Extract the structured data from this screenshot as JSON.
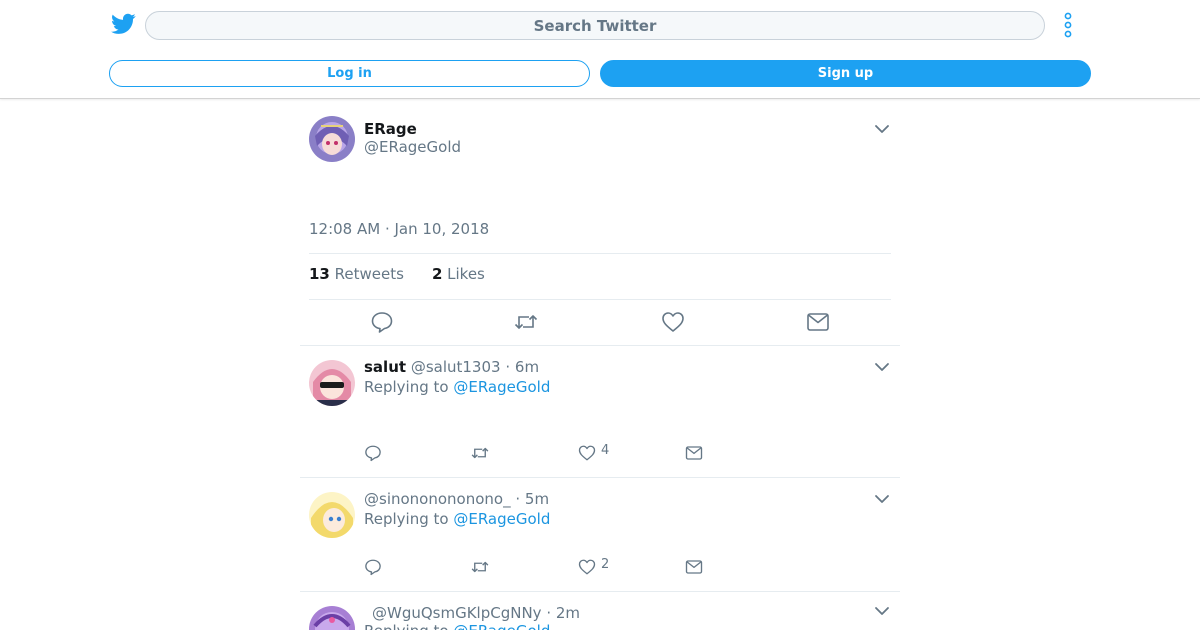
{
  "header": {
    "search_placeholder": "Search Twitter",
    "login_label": "Log in",
    "signup_label": "Sign up",
    "accent_color": "#1da1f2"
  },
  "tweet": {
    "name": "ERage",
    "handle": "@ERageGold",
    "timestamp": "12:08 AM · Jan 10, 2018",
    "retweets_count": "13",
    "retweets_label": "Retweets",
    "likes_count": "2",
    "likes_label": "Likes"
  },
  "replies": [
    {
      "name": "salut",
      "handle": "@salut1303",
      "time": "· 6m",
      "replying_prefix": "Replying to",
      "replying_to": "@ERageGold",
      "likes": "4"
    },
    {
      "name": "",
      "handle": "@sinononononono_",
      "time": "· 5m",
      "replying_prefix": "Replying to",
      "replying_to": "@ERageGold",
      "likes": "2"
    },
    {
      "name": "",
      "handle": "@WguQsmGKlpCgNNy",
      "time": "· 2m",
      "replying_prefix": "Replying to",
      "replying_to": "@ERageGold",
      "likes": ""
    }
  ],
  "icons": {
    "logo": "twitter-bird-icon",
    "more": "more-vertical-icon",
    "reply": "reply-icon",
    "retweet": "retweet-icon",
    "like": "heart-icon",
    "dm": "envelope-icon",
    "caret": "chevron-down-icon"
  }
}
